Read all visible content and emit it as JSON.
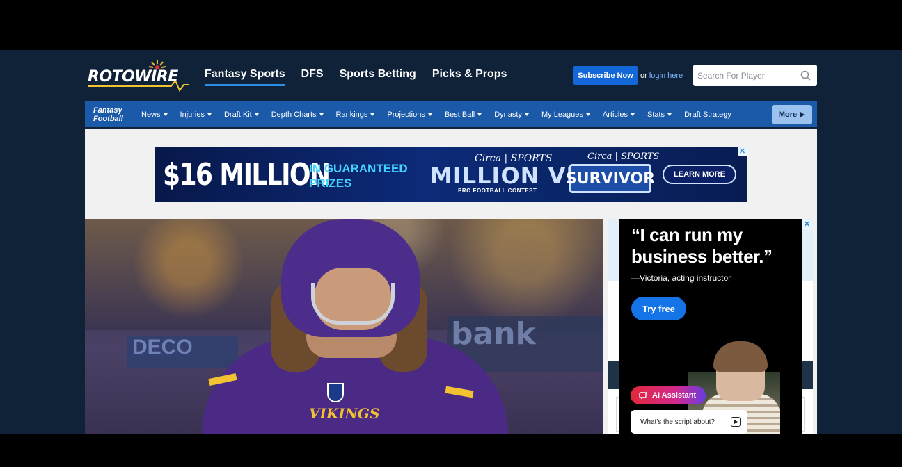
{
  "brand": {
    "logo_text": "ROTOWIRE"
  },
  "main_nav": [
    {
      "label": "Fantasy Sports",
      "active": true
    },
    {
      "label": "DFS"
    },
    {
      "label": "Sports Betting"
    },
    {
      "label": "Picks & Props"
    }
  ],
  "account": {
    "subscribe_label": "Subscribe Now",
    "or_text": "or",
    "login_label": "login here"
  },
  "search": {
    "placeholder": "Search For Player"
  },
  "sub_nav": {
    "section_line1": "Fantasy",
    "section_line2": "Football",
    "items": [
      {
        "label": "News",
        "dropdown": true
      },
      {
        "label": "Injuries",
        "dropdown": true
      },
      {
        "label": "Draft Kit",
        "dropdown": true
      },
      {
        "label": "Depth Charts",
        "dropdown": true
      },
      {
        "label": "Rankings",
        "dropdown": true
      },
      {
        "label": "Projections",
        "dropdown": true
      },
      {
        "label": "Best Ball",
        "dropdown": true
      },
      {
        "label": "Dynasty",
        "dropdown": true
      },
      {
        "label": "My Leagues",
        "dropdown": true
      },
      {
        "label": "Articles",
        "dropdown": true
      },
      {
        "label": "Stats",
        "dropdown": true
      },
      {
        "label": "Draft Strategy",
        "dropdown": false
      }
    ],
    "more_label": "More"
  },
  "banner_ad": {
    "amount": "$16 MILLION",
    "line1": "IN GUARANTEED",
    "line2": "PRIZES",
    "brand1": "Circa | SPORTS",
    "title1": "MILLION VI",
    "subtitle1": "PRO FOOTBALL CONTEST",
    "brand2": "Circa | SPORTS",
    "title2": "SURVIVOR",
    "cta": "LEARN MORE",
    "close": "✕"
  },
  "hero": {
    "board_text": "bank",
    "board2_text": "DECO",
    "jersey_text": "VIKINGS"
  },
  "side_ad": {
    "quote": "“I can run my business better.”",
    "author": "—Victoria, acting instructor",
    "cta": "Try free",
    "assistant_label": "AI Assistant",
    "prompt_text": "What's the script about?",
    "close": "✕"
  },
  "colors": {
    "page_bg": "#102238",
    "accent": "#1467d6",
    "subnav_bg": "#1b5aa8",
    "more_bg": "#9cc2ef",
    "viking_purple": "#4b2a86",
    "viking_gold": "#f2c230"
  }
}
